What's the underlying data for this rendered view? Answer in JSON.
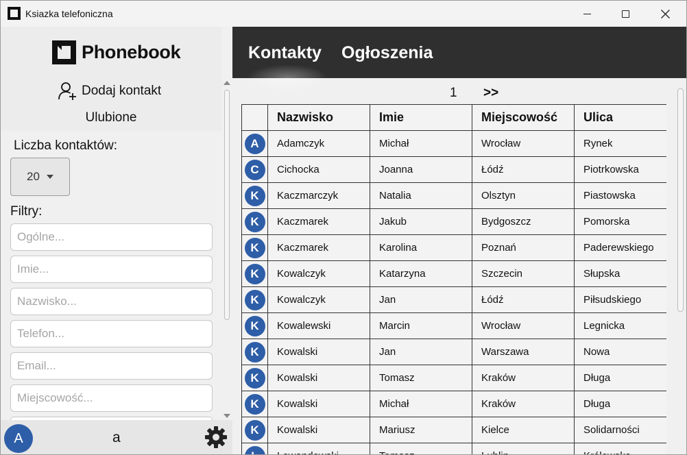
{
  "window": {
    "title": "Ksiazka telefoniczna"
  },
  "sidebar": {
    "logo_text": "Phonebook",
    "add_contact_label": "Dodaj kontakt",
    "favorites_label": "Ulubione",
    "count_label": "Liczba kontaktów:",
    "count_value": "20",
    "filters_label": "Filtry:",
    "filters": {
      "general": "Ogólne...",
      "first_name": "Imie...",
      "last_name": "Nazwisko...",
      "phone": "Telefon...",
      "email": "Email...",
      "city": "Miejscowość..."
    },
    "user_initial": "A",
    "user_name": "a"
  },
  "nav": {
    "contacts_tab": "Kontakty",
    "announcements_tab": "Ogłoszenia"
  },
  "pager": {
    "current": "1",
    "next": ">>"
  },
  "table": {
    "headers": {
      "last_name": "Nazwisko",
      "first_name": "Imie",
      "city": "Miejscowość",
      "street": "Ulica"
    },
    "rows": [
      {
        "initial": "A",
        "last_name": "Adamczyk",
        "first_name": "Michał",
        "city": "Wrocław",
        "street": "Rynek"
      },
      {
        "initial": "C",
        "last_name": "Cichocka",
        "first_name": "Joanna",
        "city": "Łódź",
        "street": "Piotrkowska"
      },
      {
        "initial": "K",
        "last_name": "Kaczmarczyk",
        "first_name": "Natalia",
        "city": "Olsztyn",
        "street": "Piastowska"
      },
      {
        "initial": "K",
        "last_name": "Kaczmarek",
        "first_name": "Jakub",
        "city": "Bydgoszcz",
        "street": "Pomorska"
      },
      {
        "initial": "K",
        "last_name": "Kaczmarek",
        "first_name": "Karolina",
        "city": "Poznań",
        "street": "Paderewskiego"
      },
      {
        "initial": "K",
        "last_name": "Kowalczyk",
        "first_name": "Katarzyna",
        "city": "Szczecin",
        "street": "Słupska"
      },
      {
        "initial": "K",
        "last_name": "Kowalczyk",
        "first_name": "Jan",
        "city": "Łódź",
        "street": "Piłsudskiego"
      },
      {
        "initial": "K",
        "last_name": "Kowalewski",
        "first_name": "Marcin",
        "city": "Wrocław",
        "street": "Legnicka"
      },
      {
        "initial": "K",
        "last_name": "Kowalski",
        "first_name": "Jan",
        "city": "Warszawa",
        "street": "Nowa"
      },
      {
        "initial": "K",
        "last_name": "Kowalski",
        "first_name": "Tomasz",
        "city": "Kraków",
        "street": "Długa"
      },
      {
        "initial": "K",
        "last_name": "Kowalski",
        "first_name": "Michał",
        "city": "Kraków",
        "street": "Długa"
      },
      {
        "initial": "K",
        "last_name": "Kowalski",
        "first_name": "Mariusz",
        "city": "Kielce",
        "street": "Solidarności"
      },
      {
        "initial": "L",
        "last_name": "Lewandowski",
        "first_name": "Tomasz",
        "city": "Lublin",
        "street": "Królewska"
      }
    ]
  },
  "colors": {
    "avatar": "#2e5ea8",
    "nav_bg": "#2f2f2f"
  }
}
